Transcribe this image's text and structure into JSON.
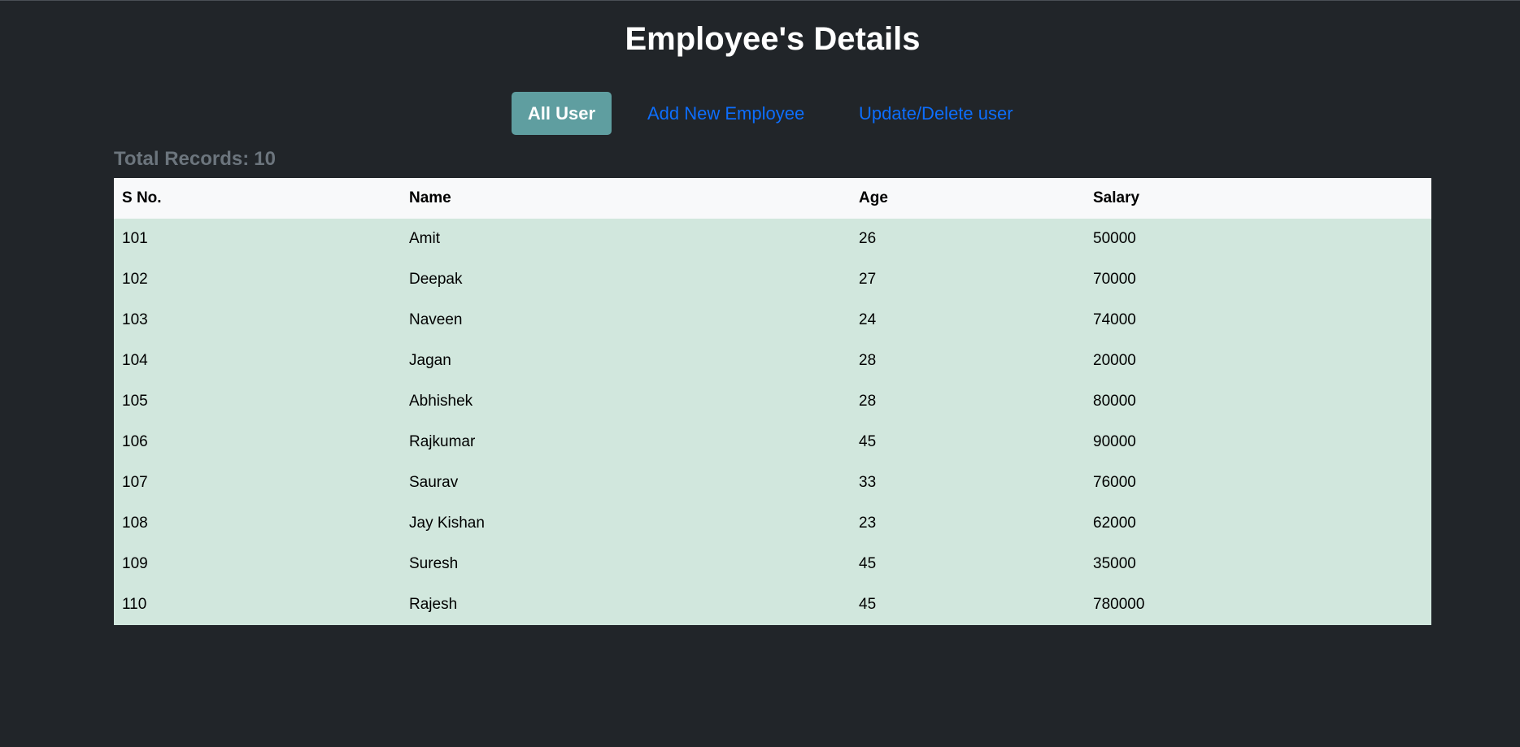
{
  "page_title": "Employee's Details",
  "nav": {
    "all_user_label": "All User",
    "add_employee_label": "Add New Employee",
    "update_delete_label": "Update/Delete user"
  },
  "records": {
    "label": "Total Records:",
    "count": "10"
  },
  "table": {
    "headers": [
      "S No.",
      "Name",
      "Age",
      "Salary"
    ],
    "rows": [
      [
        "101",
        "Amit",
        "26",
        "50000"
      ],
      [
        "102",
        "Deepak",
        "27",
        "70000"
      ],
      [
        "103",
        "Naveen",
        "24",
        "74000"
      ],
      [
        "104",
        "Jagan",
        "28",
        "20000"
      ],
      [
        "105",
        "Abhishek",
        "28",
        "80000"
      ],
      [
        "106",
        "Rajkumar",
        "45",
        "90000"
      ],
      [
        "107",
        "Saurav",
        "33",
        "76000"
      ],
      [
        "108",
        "Jay Kishan",
        "23",
        "62000"
      ],
      [
        "109",
        "Suresh",
        "45",
        "35000"
      ],
      [
        "110",
        "Rajesh",
        "45",
        "780000"
      ]
    ]
  },
  "colors": {
    "background": "#212529",
    "accent_button": "#5f9ea0",
    "link": "#0d6efd",
    "row_background": "#d1e7dd",
    "header_background": "#f8f9fa",
    "muted_text": "#6c757d"
  }
}
